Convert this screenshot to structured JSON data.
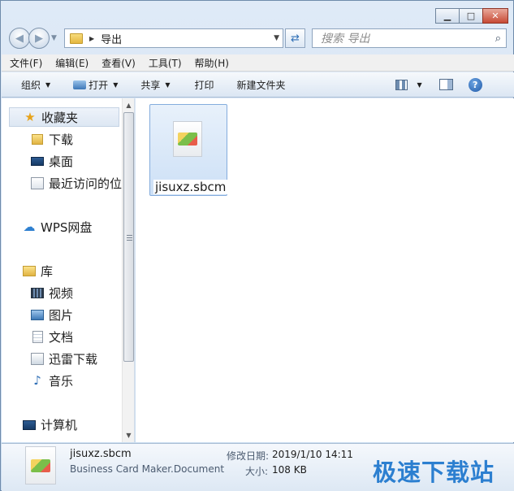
{
  "window": {
    "minimize_glyph": "▁",
    "maximize_glyph": "□",
    "close_glyph": "✕"
  },
  "address": {
    "path": "导出",
    "search_placeholder": "搜索 导出"
  },
  "menu": [
    "文件(F)",
    "编辑(E)",
    "查看(V)",
    "工具(T)",
    "帮助(H)"
  ],
  "commands": {
    "organize": "组织",
    "open": "打开",
    "share": "共享",
    "print": "打印",
    "new_folder": "新建文件夹",
    "help": "?"
  },
  "nav": {
    "favorites": "收藏夹",
    "downloads": "下载",
    "desktop": "桌面",
    "recent": "最近访问的位",
    "wps": "WPS网盘",
    "libraries": "库",
    "videos": "视频",
    "pictures": "图片",
    "documents": "文档",
    "thunder": "迅雷下载",
    "music": "音乐",
    "computer": "计算机"
  },
  "files": [
    {
      "name": "jisuxz.sbcm"
    }
  ],
  "details": {
    "name": "jisuxz.sbcm",
    "type": "Business Card Maker.Document",
    "modified_label": "修改日期:",
    "modified_value": "2019/1/10 14:11",
    "size_label": "大小:",
    "size_value": "108 KB"
  },
  "watermark": "极速下载站",
  "icons": {
    "back": "back-arrow-icon",
    "forward": "forward-arrow-icon",
    "refresh": "refresh-icon",
    "search": "search-icon",
    "help": "help-icon"
  }
}
